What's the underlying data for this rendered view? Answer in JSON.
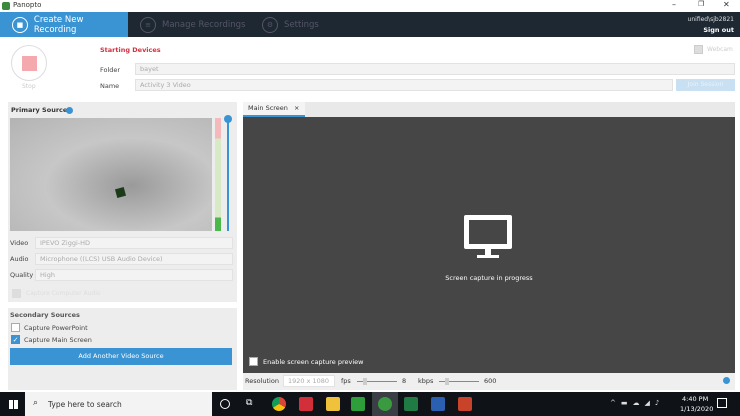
{
  "window": {
    "title": "Panopto"
  },
  "nav": {
    "tabs": [
      {
        "label": "Create New Recording"
      },
      {
        "label": "Manage Recordings"
      },
      {
        "label": "Settings"
      }
    ],
    "user": "unified\\sjb2821",
    "sign_out": "Sign out"
  },
  "recording": {
    "stop_label": "Stop",
    "status": "Starting Devices",
    "folder_label": "Folder",
    "folder_value": "bayet",
    "name_label": "Name",
    "name_value": "Activity 3 Video",
    "webcam_label": "Webcam",
    "join_session": "Join Session"
  },
  "primary": {
    "title": "Primary Sources",
    "video_label": "Video",
    "video_value": "IPEVO Ziggi-HD",
    "audio_label": "Audio",
    "audio_value": "Microphone ((LCS) USB Audio Device)",
    "quality_label": "Quality",
    "quality_value": "High",
    "computer_audio": "Capture Computer Audio"
  },
  "secondary": {
    "title": "Secondary Sources",
    "powerpoint": "Capture PowerPoint",
    "powerpoint_checked": false,
    "main_screen": "Capture Main Screen",
    "main_screen_checked": true,
    "add_button": "Add Another Video Source"
  },
  "screen": {
    "tab": "Main Screen",
    "message": "Screen capture in progress",
    "preview_label": "Enable screen capture preview",
    "resolution_label": "Resolution",
    "resolution_value": "1920 x 1080",
    "fps_label": "fps",
    "fps_value": "8",
    "kbps_label": "kbps",
    "kbps_value": "600"
  },
  "taskbar": {
    "search_placeholder": "Type here to search",
    "time": "4:40 PM",
    "date": "1/13/2020"
  },
  "colors": {
    "accent": "#3a93d2",
    "nav": "#1e2833",
    "status": "#d0313d"
  }
}
